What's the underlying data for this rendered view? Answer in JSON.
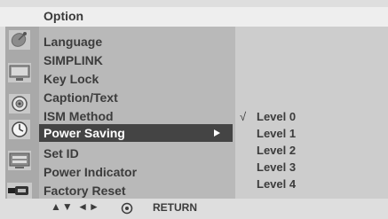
{
  "header": {
    "title": "Option"
  },
  "menu": {
    "items": [
      {
        "label": "Language",
        "icon": "satellite-dish-icon"
      },
      {
        "label": "SIMPLINK",
        "icon": "monitor-icon"
      },
      {
        "label": "Key Lock",
        "icon": "speaker-icon"
      },
      {
        "label": "Caption/Text",
        "icon": "clock-icon"
      },
      {
        "label": "ISM Method",
        "icon": "tv-screen-icon"
      },
      {
        "label": "Power Saving",
        "icon": "usb-plug-icon",
        "selected": true
      },
      {
        "label": "Set ID"
      },
      {
        "label": "Power Indicator"
      },
      {
        "label": "Factory Reset"
      }
    ]
  },
  "submenu": {
    "check_mark": "√",
    "items": [
      "Level 0",
      "Level 1",
      "Level 2",
      "Level 3",
      "Level 4"
    ],
    "selected_index": 0
  },
  "footer": {
    "nav_hint": "▲▼ ◄►",
    "enter_icon": "ok-circle-icon",
    "return_label": "RETURN"
  },
  "colors": {
    "background": "#dedede",
    "header": "#eeeeee",
    "icon_column": "#a9a9a9",
    "menu_panel": "#b9b9b9",
    "submenu_panel": "#cdcdcd",
    "selected_bar": "#444444",
    "text": "#3c3c3c"
  }
}
